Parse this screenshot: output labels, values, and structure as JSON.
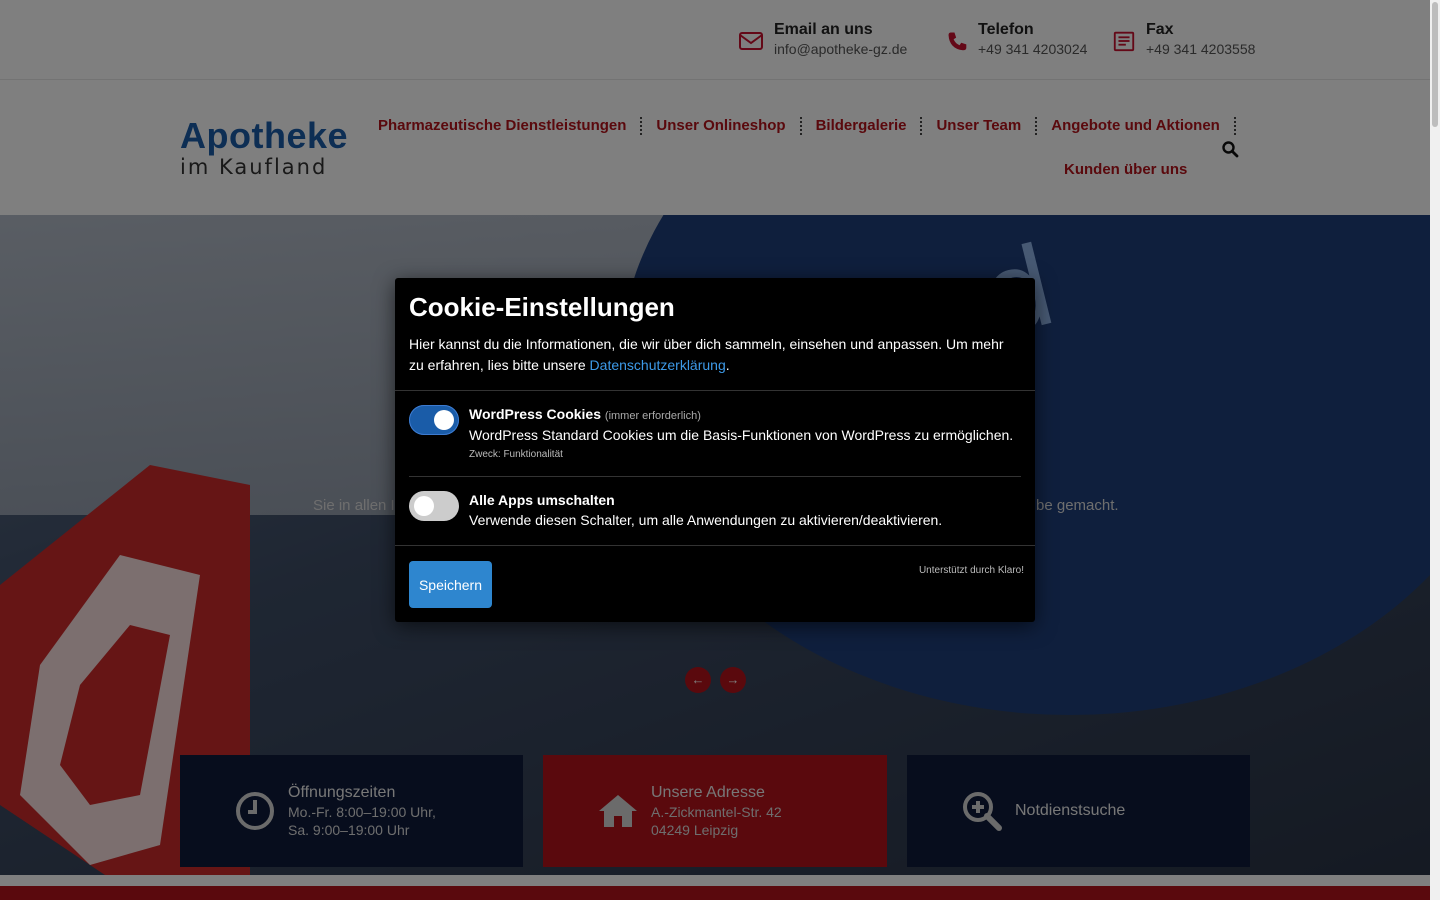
{
  "contacts": [
    {
      "title": "Email an uns",
      "value": "info@apotheke-gz.de",
      "icon": "envelope-icon"
    },
    {
      "title": "Telefon",
      "value": "+49 341 4203024",
      "icon": "phone-icon"
    },
    {
      "title": "Fax",
      "value": "+49 341 4203558",
      "icon": "fax-icon"
    }
  ],
  "logo": {
    "line1": "Apotheke",
    "line2": "im Kaufland"
  },
  "nav": {
    "items": [
      "Pharmazeutische Dienstleistungen",
      "Unser Onlineshop",
      "Bildergalerie",
      "Unser Team",
      "Angebote und Aktionen"
    ],
    "second_row": "Kunden über uns"
  },
  "hero": {
    "text_left": "Sie in allen I",
    "text_right": "be gemacht.",
    "prev_icon": "arrow-left-icon",
    "next_icon": "arrow-right-icon"
  },
  "info_boxes": [
    {
      "title": "Öffnungszeiten",
      "lines": [
        "Mo.-Fr. 8:00–19:00 Uhr,",
        "Sa. 9:00–19:00 Uhr"
      ],
      "icon": "clock-icon",
      "color": "#0e1a3a"
    },
    {
      "title": "Unsere Adresse",
      "lines": [
        "A.-Zickmantel-Str. 42",
        "04249 Leipzig"
      ],
      "icon": "home-icon",
      "color": "#b5121b"
    },
    {
      "title": "Notdienstsuche",
      "lines": [],
      "icon": "zoom-in-icon",
      "color": "#0e1a3a"
    }
  ],
  "cookie": {
    "title": "Cookie-Einstellungen",
    "desc_before": "Hier kannst du die Informationen, die wir über dich sammeln, einsehen und anpassen. Um mehr zu erfahren, lies bitte unsere ",
    "desc_link": "Datenschutzerklärung",
    "desc_after": ".",
    "services": [
      {
        "title": "WordPress Cookies",
        "required": "(immer erforderlich)",
        "desc": "WordPress Standard Cookies um die Basis-Funktionen von WordPress zu ermöglichen.",
        "purpose": "Zweck: Funktionalität",
        "enabled": true
      },
      {
        "title": "Alle Apps umschalten",
        "desc": "Verwende diesen Schalter, um alle Anwendungen zu aktivieren/deaktivieren.",
        "enabled": false
      }
    ],
    "save_label": "Speichern",
    "powered_by": "Unterstützt durch Klaro!"
  },
  "colors": {
    "brand_red": "#b5121b",
    "brand_blue": "#1a5ca8",
    "link_blue": "#3d9ae8",
    "button_blue": "#2e86cf"
  }
}
